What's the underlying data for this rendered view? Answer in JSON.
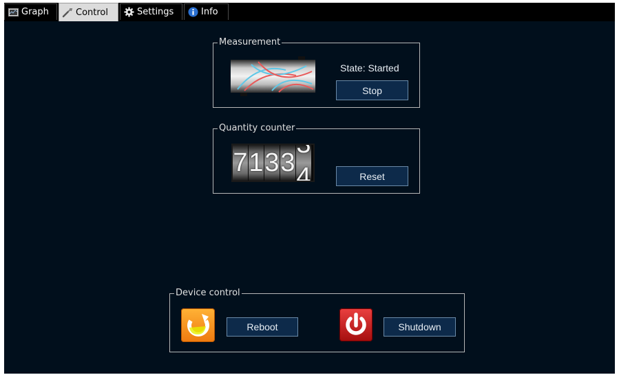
{
  "tabs": [
    {
      "label": "Graph",
      "icon": "graph-icon"
    },
    {
      "label": "Control",
      "icon": "wrench-icon",
      "active": true
    },
    {
      "label": "Settings",
      "icon": "gear-icon"
    },
    {
      "label": "Info",
      "icon": "info-icon"
    }
  ],
  "measurement": {
    "title": "Measurement",
    "state_text": "State: Started",
    "stop_label": "Stop",
    "image_icon": "flow-sensor-icon"
  },
  "quantity": {
    "title": "Quantity counter",
    "digits": [
      "7",
      "1",
      "3",
      "3",
      "4"
    ],
    "reset_label": "Reset"
  },
  "device": {
    "title": "Device control",
    "reboot_label": "Reboot",
    "shutdown_label": "Shutdown",
    "reboot_icon": "reboot-icon",
    "shutdown_icon": "power-icon"
  },
  "colors": {
    "background": "#010f1c",
    "button_bg": "#0d2a4a",
    "reboot_orange": "#f7a51c",
    "shutdown_red": "#d32020"
  }
}
